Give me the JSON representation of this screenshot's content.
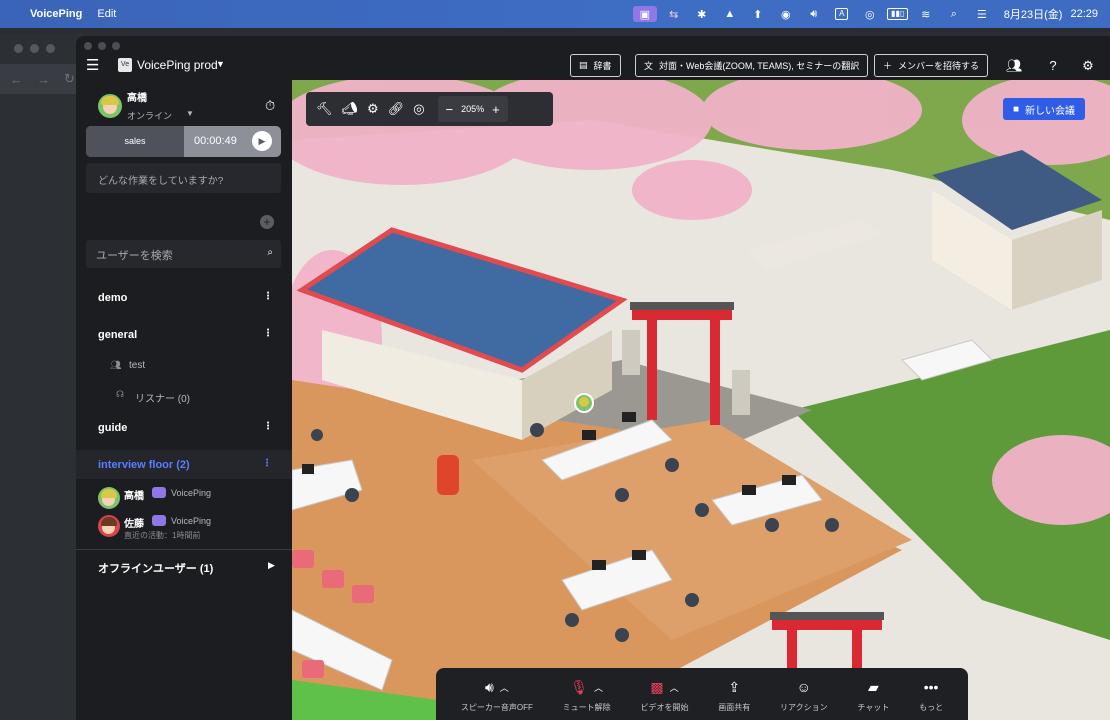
{
  "menubar": {
    "app_name": "VoicePing",
    "edit": "Edit",
    "input_label": "A",
    "date": "8月23日(金)",
    "time": "22:29"
  },
  "header": {
    "workspace_logo": "Ve",
    "workspace_name": "VoicePing prod",
    "dictionary_button": "辞書",
    "translation_button": "対面・Web会議(ZOOM, TEAMS), セミナーの翻訳",
    "invite_button": "メンバーを招待する"
  },
  "sidebar": {
    "user_name": "高橋",
    "user_status": "オンライン",
    "task": {
      "label": "sales",
      "elapsed": "00:00:49"
    },
    "task_placeholder": "どんな作業をしていますか?",
    "search_placeholder": "ユーザーを検索",
    "rooms": [
      {
        "name": "demo"
      },
      {
        "name": "general",
        "subitems": [
          "test",
          "リスナー (0)"
        ]
      },
      {
        "name": "guide"
      }
    ],
    "active_room": {
      "name": "interview floor (2)",
      "members": [
        {
          "name": "高橋",
          "app": "VoicePing",
          "recent": ""
        },
        {
          "name": "佐藤",
          "app": "VoicePing",
          "recent": "直近の活動：1時間前"
        }
      ]
    },
    "offline_users": "オフラインユーザー (1)"
  },
  "map": {
    "zoom": "205%",
    "new_meeting": "新しい会議"
  },
  "bottombar": {
    "items": [
      {
        "label": "スピーカー音声OFF",
        "icon": "speaker-icon"
      },
      {
        "label": "ミュート解除",
        "icon": "mic-off-icon"
      },
      {
        "label": "ビデオを開始",
        "icon": "video-off-icon"
      },
      {
        "label": "画面共有",
        "icon": "screen-share-icon"
      },
      {
        "label": "リアクション",
        "icon": "emoji-icon"
      },
      {
        "label": "チャット",
        "icon": "chat-icon"
      },
      {
        "label": "もっと",
        "icon": "more-icon"
      }
    ]
  },
  "colors": {
    "accent": "#5b7dff",
    "new_meeting": "#2f5de8",
    "muted_red": "#e8405a",
    "menubar": "#3e6dc4"
  }
}
